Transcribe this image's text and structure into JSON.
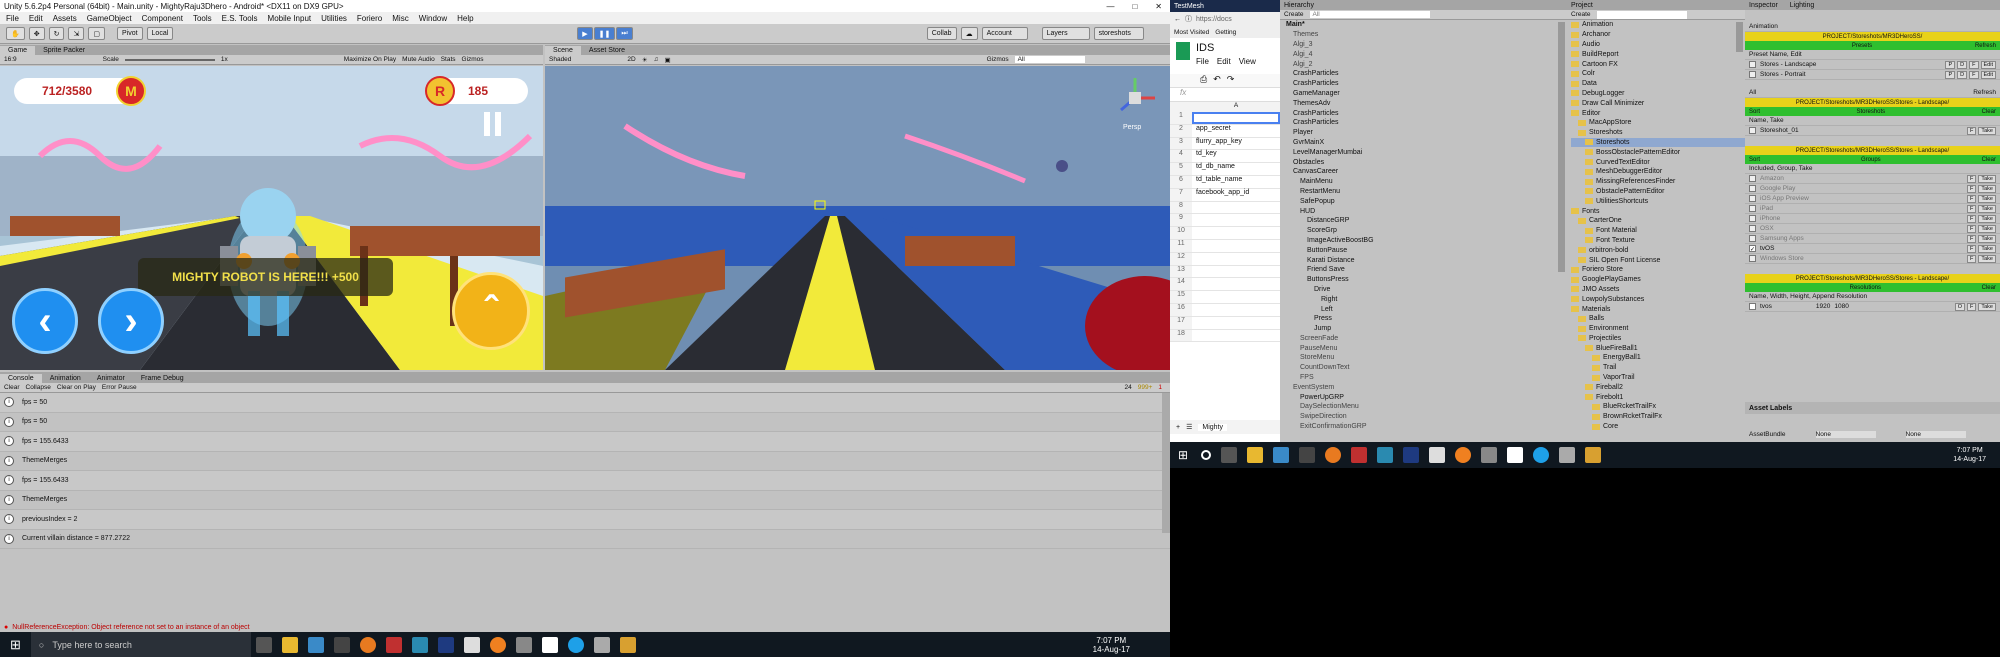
{
  "unity": {
    "title": "Unity 5.6.2p4 Personal (64bit) - Main.unity - MightyRaju3Dhero - Android* <DX11 on DX9 GPU>",
    "menu": [
      "File",
      "Edit",
      "Assets",
      "GameObject",
      "Component",
      "Tools",
      "E.S. Tools",
      "Mobile Input",
      "Utilities",
      "Foriero",
      "Misc",
      "Window",
      "Help"
    ],
    "toolbar": {
      "pivot": "Pivot",
      "local": "Local",
      "collab": "Collab",
      "account": "Account",
      "layers": "Layers",
      "layout": "storeshots"
    },
    "game_tabs": [
      "Game",
      "Sprite Packer"
    ],
    "game_sub": {
      "aspect": "16:9",
      "scale_label": "Scale",
      "scale_val": "1x",
      "maximize": "Maximize On Play",
      "mute": "Mute Audio",
      "stats": "Stats",
      "gizmos": "Gizmos"
    },
    "scene_tabs": [
      "Scene",
      "Asset Store"
    ],
    "scene_sub": {
      "shading": "Shaded",
      "mode": "2D",
      "gizmos": "Gizmos",
      "search": "All",
      "persp": "Persp"
    },
    "hud": {
      "score": "712/3580",
      "coins": "185",
      "banner": "MIGHTY ROBOT IS HERE!!! +500",
      "badge_m": "M",
      "badge_r": "R"
    },
    "console_tabs": [
      "Console",
      "Animation",
      "Animator",
      "Frame Debug"
    ],
    "console_bar": [
      "Clear",
      "Collapse",
      "Clear on Play",
      "Error Pause"
    ],
    "counts": {
      "logs": "24",
      "warn": "999+",
      "err": "1"
    },
    "logs": [
      "fps = 50",
      "fps = 50",
      "fps = 155.6433",
      "ThemeMerges",
      "fps = 155.6433",
      "ThemeMerges",
      "previousIndex = 2",
      "Current villain distance = 877.2722"
    ],
    "error": "NullReferenceException: Object reference not set to an instance of an object"
  },
  "taskbar_left": {
    "search": "Type here to search",
    "time": "7:07 PM",
    "date": "14-Aug-17"
  },
  "taskbar_right": {
    "time": "7:07 PM",
    "date": "14-Aug-17"
  },
  "browser": {
    "tab": "TestMesh",
    "url": "https://docs",
    "bookmark1": "Most Visited",
    "bookmark2": "Getting",
    "doc": "IDS",
    "menu": [
      "File",
      "Edit",
      "View"
    ],
    "col": "A",
    "cells": [
      "",
      "app_secret",
      "flurry_app_key",
      "td_key",
      "td_db_name",
      "td_table_name",
      "facebook_app_id",
      "",
      "",
      "",
      "",
      "",
      "",
      "",
      "",
      "",
      "",
      ""
    ],
    "sheet": "Mighty"
  },
  "hierarchy": {
    "title": "Hierarchy",
    "create": "Create",
    "search": "All",
    "items": [
      "Main*",
      "Themes",
      "Algi_3",
      "Algi_4",
      "Algi_2",
      "CrashParticles",
      "CrashParticles",
      "GameManager",
      "ThemesAdv",
      "CrashParticles",
      "CrashParticles",
      "Player",
      "GvrMainX",
      "LevelManagerMumbai",
      "Obstacles",
      "CanvasCareer",
      "MainMenu",
      "RestartMenu",
      "SafePopup",
      "HUD",
      "DistanceGRP",
      "ScoreGrp",
      "ImageActiveBoostBG",
      "ButtonPause",
      "Karati Distance",
      "Friend Save",
      "ButtonsPress",
      "Drive",
      "Right",
      "Left",
      "Press",
      "Jump",
      "ScreenFade",
      "PauseMenu",
      "StoreMenu",
      "CountDownText",
      "FPS",
      "EventSystem",
      "PowerUpGRP",
      "DaySelectionMenu",
      "SwipeDirection",
      "ExitConfirmationGRP"
    ]
  },
  "project": {
    "title": "Project",
    "create": "Create",
    "items": [
      "Animation",
      "Archanor",
      "Audio",
      "BuildReport",
      "Cartoon FX",
      "Colr",
      "Data",
      "DebugLogger",
      "Draw Call Minimizer",
      "Editor",
      "MacAppStore",
      "Storeshots",
      "Storeshots",
      "BossObstaclePatternEditor",
      "CurvedTextEditor",
      "MeshDebuggerEditor",
      "MissingReferencesFinder",
      "ObstaclePatternEditor",
      "UtilitiesShortcuts",
      "Fonts",
      "CarterOne",
      "Font Material",
      "Font Texture",
      "orbitron-bold",
      "SIL Open Font License",
      "Foriero Store",
      "GooglePlayGames",
      "JMO Assets",
      "LowpolySubstances",
      "Materials",
      "Balls",
      "Environment",
      "Projectiles",
      "BlueFireBall1",
      "EnergyBall1",
      "Trail",
      "VaporTrail",
      "Fireball2",
      "Firebolt1",
      "BlueRcketTrailFx",
      "BrownRcketTrailFx",
      "Core"
    ]
  },
  "inspector": {
    "tabs": [
      "Inspector",
      "Lighting"
    ],
    "sec1": {
      "header": "Animation",
      "path": "PROJECT/Storeshots/MR3DHeroSS/",
      "presets": "Presets",
      "refresh": "Refresh",
      "label": "Preset Name, Edit",
      "rows": [
        "Stores - Landscape",
        "Stores - Portrait"
      ]
    },
    "sec2": {
      "tab_all": "All",
      "tab_refresh": "Refresh",
      "path": "PROJECT/Storeshots/MR3DHeroSS/Stores - Landscape/",
      "bar": "Storeshots",
      "sort": "Sort",
      "clear": "Clear",
      "label": "Name, Take",
      "rows": [
        "Storeshot_01"
      ]
    },
    "sec3": {
      "path": "PROJECT/Storeshots/MR3DHeroSS/Stores - Landscape/",
      "bar": "Groups",
      "sort": "Sort",
      "clear": "Clear",
      "label": "Included, Group, Take",
      "rows": [
        "Amazon",
        "Google Play",
        "iOS App Preview",
        "iPad",
        "iPhone",
        "OSX",
        "Samsung Apps",
        "tvOS",
        "Windows Store"
      ]
    },
    "sec4": {
      "path": "PROJECT/Storeshots/MR3DHeroSS/Stores - Landscape/",
      "bar": "Resolutions",
      "clear": "Clear",
      "label": "Name, Width, Height, Append Resolution",
      "row": "tvos",
      "w": "1920",
      "h": "1080"
    },
    "asset_labels": "Asset Labels",
    "asset_bundle": "AssetBundle",
    "ab_none": "None",
    "ab_none2": "None"
  },
  "colors": {
    "accent_yellow": "#e8d21a",
    "accent_green": "#2fbf2f",
    "road": "#2a2c33",
    "side_yellow": "#f2ea3a",
    "sky": "#bcd3e6"
  }
}
